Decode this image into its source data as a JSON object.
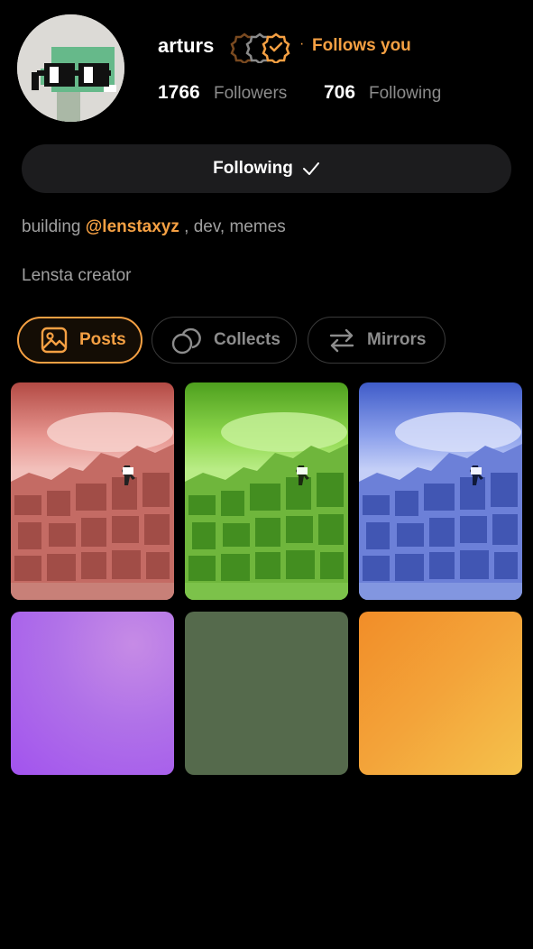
{
  "profile": {
    "username": "arturs",
    "follows_you": "Follows you",
    "separator": "·",
    "followers_count": "1766",
    "followers_label": "Followers",
    "following_count": "706",
    "following_label": "Following"
  },
  "follow_button": {
    "label": "Following"
  },
  "bio": {
    "line1_prefix": "building ",
    "line1_mention": "@lenstaxyz",
    "line1_suffix": " , dev, memes",
    "line2": "Lensta creator"
  },
  "tabs": [
    {
      "label": "Posts",
      "icon": "image-icon",
      "active": true
    },
    {
      "label": "Collects",
      "icon": "collect-icon",
      "active": false
    },
    {
      "label": "Mirrors",
      "icon": "mirror-icon",
      "active": false
    }
  ],
  "grid": [
    {
      "kind": "photo",
      "tint": "red"
    },
    {
      "kind": "photo",
      "tint": "green"
    },
    {
      "kind": "photo",
      "tint": "blue"
    },
    {
      "kind": "gradient",
      "color": "purple"
    },
    {
      "kind": "solid",
      "color": "olive"
    },
    {
      "kind": "gradient",
      "color": "orange"
    }
  ],
  "colors": {
    "background": "#000000",
    "accent": "#f5a043",
    "muted": "#8c8c8c",
    "button_bg": "#1c1c1e"
  }
}
